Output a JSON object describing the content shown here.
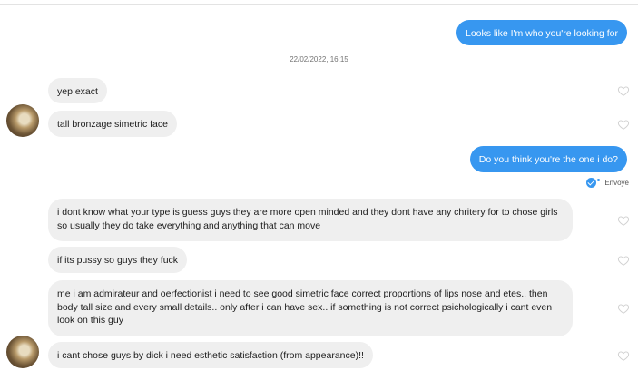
{
  "timestamp": "22/02/2022, 16:15",
  "seen_label": "Envoyé",
  "messages": [
    {
      "text": "Looks like I'm who you're looking for"
    },
    {
      "text": "yep exact"
    },
    {
      "text": "tall bronzage simetric face"
    },
    {
      "text": "Do you think you're the one i do?"
    },
    {
      "text": "i dont know what your type is guess guys they are more open minded and they dont have any chritery for to chose girls so usually they do take everything and anything that can move"
    },
    {
      "text": "if its pussy so guys they fuck"
    },
    {
      "text": "me i am admirateur and oerfectionist i need to see good simetric face correct proportions of lips nose and etes.. then body tall size and every small details.. only after i can have sex.. if something is not correct psichologically i cant even look on this guy"
    },
    {
      "text": "i cant chose guys by dick i need esthetic satisfaction (from appearance)!!"
    }
  ],
  "colors": {
    "outgoing": "#3797f0",
    "incoming": "#efefef"
  }
}
